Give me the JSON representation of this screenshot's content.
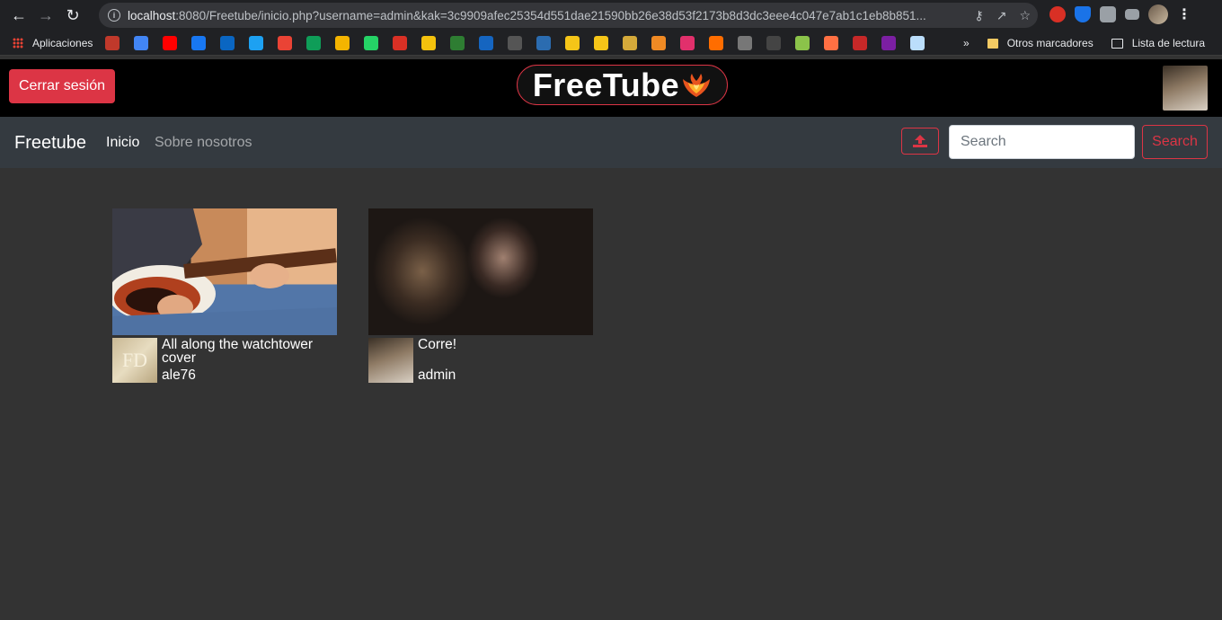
{
  "browser": {
    "url_host": "localhost",
    "url_rest": ":8080/Freetube/inicio.php?username=admin&kak=3c9909afec25354d551dae21590bb26e38d53f2173b8d3dc3eee4c047e7ab1c1eb8b851...",
    "bookmarks_apps_label": "Aplicaciones",
    "bookmarks_overflow": "»",
    "other_bookmarks_label": "Otros marcadores",
    "reading_list_label": "Lista de lectura",
    "favicons": [
      "#c0392b",
      "#4285f4",
      "#ff0000",
      "#1877f2",
      "#0a66c2",
      "#1da1f2",
      "#ea4335",
      "#0f9d58",
      "#f4b400",
      "#25d366",
      "#d93025",
      "#f4c20d",
      "#2e7d32",
      "#1565c0",
      "#555",
      "#2b6cb0",
      "#f5c518",
      "#f5c518",
      "#d4a93a",
      "#f08a24",
      "#e1306c",
      "#ff6d00",
      "#777",
      "#444",
      "#8bc34a",
      "#ff7043",
      "#c62828",
      "#7b1fa2",
      "#bbdefb"
    ]
  },
  "header": {
    "logout_label": "Cerrar sesión",
    "logo_text": "FreeTube"
  },
  "navbar": {
    "brand": "Freetube",
    "links": [
      {
        "label": "Inicio",
        "active": true
      },
      {
        "label": "Sobre nosotros",
        "active": false
      }
    ],
    "search_placeholder": "Search",
    "search_button": "Search"
  },
  "videos": [
    {
      "title": "All along the watchtower cover",
      "author": "ale76",
      "avatar_initials": "FD"
    },
    {
      "title": "Corre!",
      "author": "admin"
    }
  ],
  "colors": {
    "accent": "#dc3545",
    "navbar_bg": "#343a40",
    "page_bg": "#333333",
    "header_bg": "#000000"
  }
}
